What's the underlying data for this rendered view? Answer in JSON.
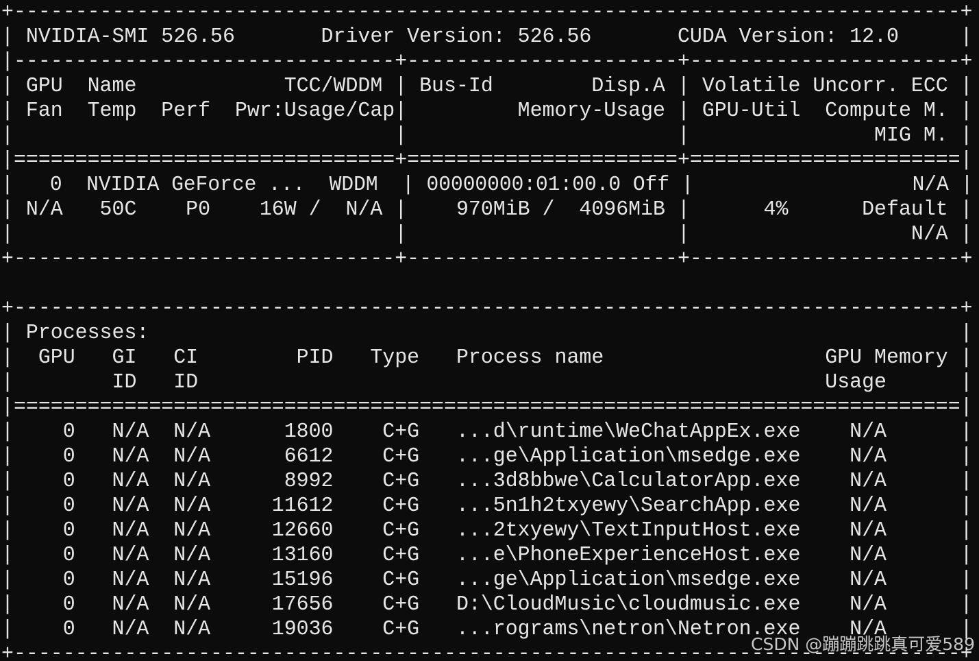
{
  "terminal": {
    "gpu_table": [
      "+-----------------------------------------------------------------------------+",
      "| NVIDIA-SMI 526.56       Driver Version: 526.56       CUDA Version: 12.0     |",
      "|-------------------------------+----------------------+----------------------+",
      "| GPU  Name            TCC/WDDM | Bus-Id        Disp.A | Volatile Uncorr. ECC |",
      "| Fan  Temp  Perf  Pwr:Usage/Cap|         Memory-Usage | GPU-Util  Compute M. |",
      "|                               |                      |               MIG M. |",
      "|===============================+======================+======================|",
      "|   0  NVIDIA GeForce ...  WDDM  | 00000000:01:00.0 Off |                  N/A |",
      "| N/A   50C    P0    16W /  N/A |    970MiB /  4096MiB |      4%      Default |",
      "|                               |                      |                  N/A |",
      "+-------------------------------+----------------------+----------------------+"
    ],
    "process_table": [
      "+-----------------------------------------------------------------------------+",
      "| Processes:                                                                  |",
      "|  GPU   GI   CI        PID   Type   Process name                  GPU Memory |",
      "|        ID   ID                                                   Usage      |",
      "|=============================================================================|",
      "|    0   N/A  N/A      1800    C+G   ...d\\runtime\\WeChatAppEx.exe    N/A      |",
      "|    0   N/A  N/A      6612    C+G   ...ge\\Application\\msedge.exe    N/A      |",
      "|    0   N/A  N/A      8992    C+G   ...3d8bbwe\\CalculatorApp.exe    N/A      |",
      "|    0   N/A  N/A     11612    C+G   ...5n1h2txyewy\\SearchApp.exe    N/A      |",
      "|    0   N/A  N/A     12660    C+G   ...2txyewy\\TextInputHost.exe    N/A      |",
      "|    0   N/A  N/A     13160    C+G   ...e\\PhoneExperienceHost.exe    N/A      |",
      "|    0   N/A  N/A     15196    C+G   ...ge\\Application\\msedge.exe    N/A      |",
      "|    0   N/A  N/A     17656    C+G   D:\\CloudMusic\\cloudmusic.exe    N/A      |",
      "|    0   N/A  N/A     19036    C+G   ...rograms\\netron\\Netron.exe    N/A      |",
      "+-----------------------------------------------------------------------------+"
    ]
  },
  "watermark": "CSDN @蹦蹦跳跳真可爱589",
  "colors": {
    "background": "#0c0c0c",
    "foreground": "#e6e6e6"
  }
}
